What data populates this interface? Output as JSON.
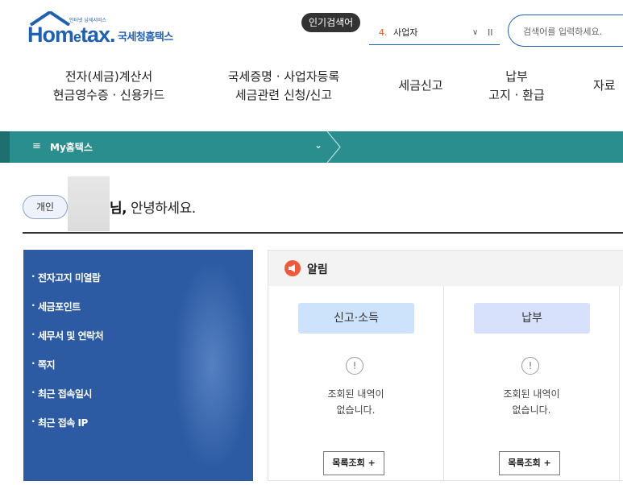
{
  "logo": {
    "small": "인터넷 납세서비스",
    "main_a": "Hom",
    "main_e": "e",
    "main_b": "tax.",
    "sub": "국세청홈택스"
  },
  "popular": {
    "badge": "인기검색어",
    "rank": "4.",
    "keyword": "사업자",
    "chevron": "∨",
    "pause": "II"
  },
  "search": {
    "placeholder": "검색어를 입력하세요."
  },
  "gnb": [
    {
      "line1": "전자(세금)계산서",
      "line2": "현금영수증 · 신용카드"
    },
    {
      "line1": "국세증명 · 사업자등록",
      "line2": "세금관련 신청/신고"
    },
    {
      "line1": "세금신고"
    },
    {
      "line1": "납부",
      "line2": "고지 · 환급"
    },
    {
      "line1": "자료"
    }
  ],
  "mybar": {
    "menu_icon": "≡",
    "title": "My홈택스",
    "dropdown": "⌄"
  },
  "greeting": {
    "badge": "개인",
    "name_suffix": "님,",
    "text": " 안녕하세요."
  },
  "side_menu": [
    {
      "label": "전자고지 미열람"
    },
    {
      "label": "세금포인트"
    },
    {
      "label": "세무서 및 연락처"
    },
    {
      "label": "쪽지"
    },
    {
      "label": "최근 접속일시"
    },
    {
      "label": "최근 접속 IP"
    }
  ],
  "notice": {
    "title": "알림",
    "cards": [
      {
        "head": "신고·소득",
        "color": "#cde3fb",
        "message1": "조회된 내역이",
        "message2": "없습니다.",
        "button": "목록조회 +"
      },
      {
        "head": "납부",
        "color": "#d7e1fb",
        "message1": "조회된 내역이",
        "message2": "없습니다.",
        "button": "목록조회 +"
      }
    ]
  },
  "colors": {
    "brand": "#1e60b3",
    "bar": "#2b8e8e",
    "side": "#2d5ba3",
    "rank": "#e8531b",
    "alert": "#f0583c"
  },
  "icons": {
    "logo_house": "house-icon",
    "alert": "megaphone-icon",
    "warn": "exclamation-icon"
  }
}
